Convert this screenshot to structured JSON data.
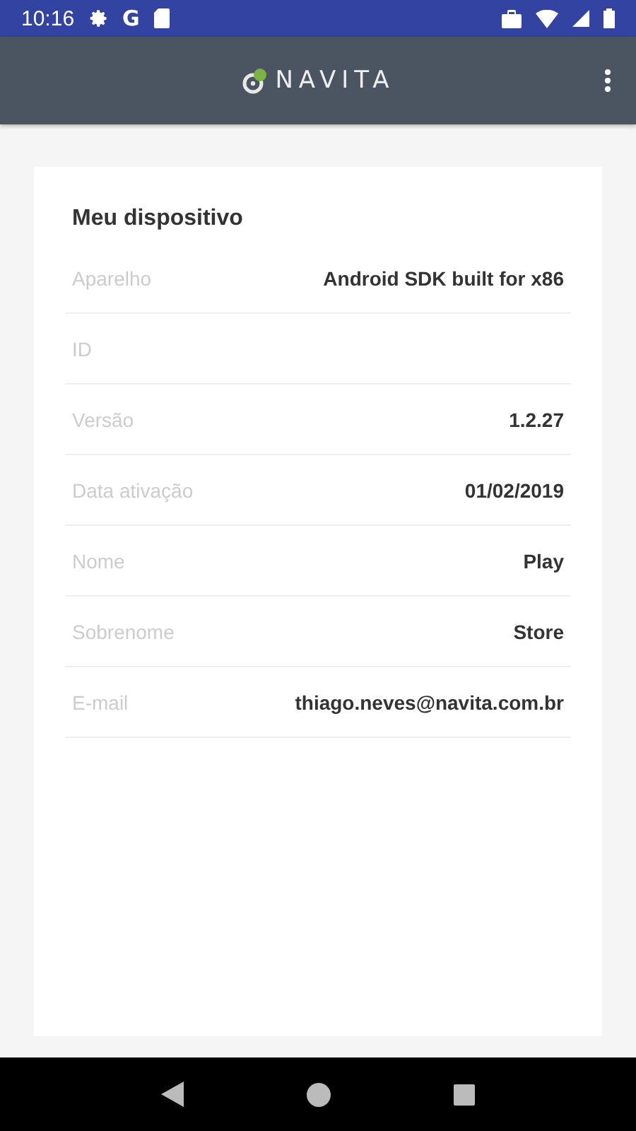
{
  "status_bar": {
    "time": "10:16",
    "google": "G"
  },
  "app_bar": {
    "logo": "NAVITA"
  },
  "card": {
    "title": "Meu dispositivo",
    "rows": [
      {
        "label": "Aparelho",
        "value": "Android SDK built for x86"
      },
      {
        "label": "ID"
      },
      {
        "label": "Versão",
        "value": "1.2.27"
      },
      {
        "label": "Data ativação",
        "value": "01/02/2019"
      },
      {
        "label": "Nome",
        "value": "Play"
      },
      {
        "label": "Sobrenome",
        "value": "Store"
      },
      {
        "label": "E-mail",
        "value": "thiago.neves@navita.com.br"
      }
    ]
  }
}
